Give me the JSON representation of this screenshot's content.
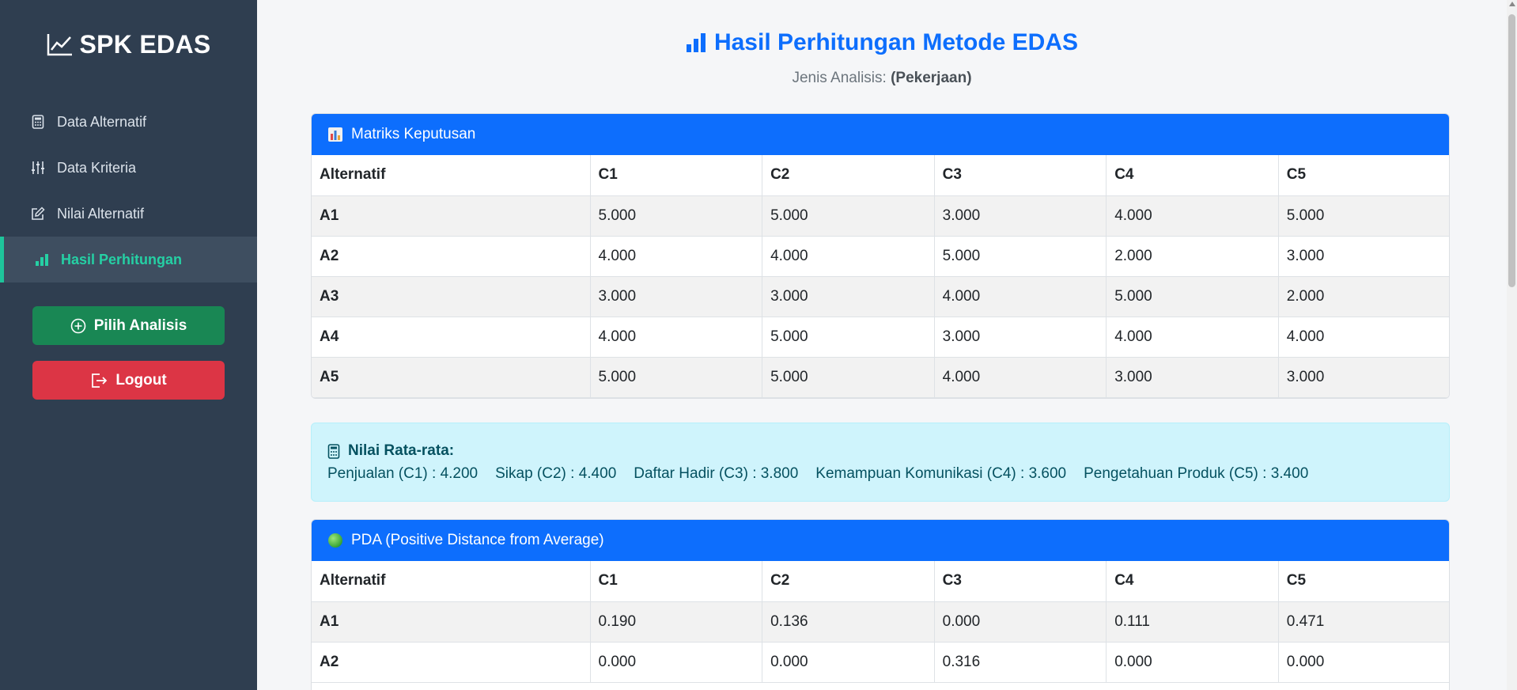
{
  "sidebar": {
    "brand": "SPK EDAS",
    "items": [
      {
        "label": "Data Alternatif",
        "icon": "calculator-icon"
      },
      {
        "label": "Data Kriteria",
        "icon": "sliders-icon"
      },
      {
        "label": "Nilai Alternatif",
        "icon": "edit-icon"
      },
      {
        "label": "Hasil Perhitungan",
        "icon": "bar-chart-icon",
        "active": true
      }
    ],
    "pilih_label": "Pilih Analisis",
    "logout_label": "Logout"
  },
  "header": {
    "title": "Hasil Perhitungan Metode EDAS",
    "subtitle_prefix": "Jenis Analisis: ",
    "subtitle_value": "(Pekerjaan)"
  },
  "matriks": {
    "title": "Matriks Keputusan",
    "columns": [
      "Alternatif",
      "C1",
      "C2",
      "C3",
      "C4",
      "C5"
    ],
    "rows": [
      [
        "A1",
        "5.000",
        "5.000",
        "3.000",
        "4.000",
        "5.000"
      ],
      [
        "A2",
        "4.000",
        "4.000",
        "5.000",
        "2.000",
        "3.000"
      ],
      [
        "A3",
        "3.000",
        "3.000",
        "4.000",
        "5.000",
        "2.000"
      ],
      [
        "A4",
        "4.000",
        "5.000",
        "3.000",
        "4.000",
        "4.000"
      ],
      [
        "A5",
        "5.000",
        "5.000",
        "4.000",
        "3.000",
        "3.000"
      ]
    ]
  },
  "rata_rata": {
    "title": "Nilai Rata-rata:",
    "values": [
      "Penjualan (C1) : 4.200",
      "Sikap (C2) : 4.400",
      "Daftar Hadir (C3) : 3.800",
      "Kemampuan Komunikasi (C4) : 3.600",
      "Pengetahuan Produk (C5) : 3.400"
    ]
  },
  "pda": {
    "title": "PDA (Positive Distance from Average)",
    "columns": [
      "Alternatif",
      "C1",
      "C2",
      "C3",
      "C4",
      "C5"
    ],
    "rows": [
      [
        "A1",
        "0.190",
        "0.136",
        "0.000",
        "0.111",
        "0.471"
      ],
      [
        "A2",
        "0.000",
        "0.000",
        "0.316",
        "0.000",
        "0.000"
      ]
    ]
  },
  "colors": {
    "sidebar_bg": "#2f3e50",
    "accent": "#0d6efd",
    "active": "#25d0a4",
    "success": "#198754",
    "danger": "#dc3545",
    "info_bg": "#cff4fc"
  }
}
